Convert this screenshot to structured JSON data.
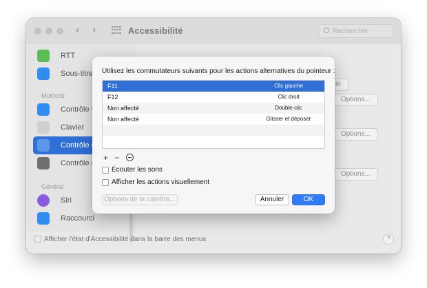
{
  "window": {
    "title": "Accessibilité",
    "search_placeholder": "Rechercher"
  },
  "sidebar": {
    "items": [
      {
        "label": "RTT",
        "icon": "rtt-icon",
        "color": "#5bbd58"
      },
      {
        "label": "Sous-titres",
        "icon": "subtitles-icon",
        "color": "#2f8cf0"
      },
      {
        "label": "Contrôle vo",
        "icon": "voice-control-icon",
        "color": "#2f8cf0"
      },
      {
        "label": "Clavier",
        "icon": "keyboard-icon",
        "color": "#bdbdbd"
      },
      {
        "label": "Contrôle du",
        "icon": "pointer-control-icon",
        "color": "#2f6fd6"
      },
      {
        "label": "Contrôle de",
        "icon": "switch-control-icon",
        "color": "#6e6e6e"
      },
      {
        "label": "Siri",
        "icon": "siri-icon",
        "color": "#8a5be0"
      },
      {
        "label": "Raccourci",
        "icon": "shortcut-icon",
        "color": "#2f8cf0"
      }
    ],
    "sections": [
      "Motricité",
      "Général"
    ]
  },
  "content": {
    "buttons": [
      "le",
      "Options...",
      "Options...",
      "Options..."
    ]
  },
  "footer": {
    "menu_bar_label": "Afficher l'état d'Accessibilité dans la barre des menus",
    "help": "?"
  },
  "sheet": {
    "prompt": "Utilisez les commutateurs suivants pour les actions alternatives du pointeur :",
    "rows": [
      {
        "key": "F11",
        "action": "Clic gauche",
        "selected": true
      },
      {
        "key": "F12",
        "action": "Clic droit",
        "selected": false
      },
      {
        "key": "Non affecté",
        "action": "Double-clic",
        "selected": false
      },
      {
        "key": "Non affecté",
        "action": "Glisser et déposer",
        "selected": false
      }
    ],
    "tools": {
      "add": "+",
      "remove": "−"
    },
    "checkboxes": {
      "sounds": "Écouter les sons",
      "visual": "Afficher les actions visuellement"
    },
    "buttons": {
      "camera": "Options de la caméra...",
      "cancel": "Annuler",
      "ok": "OK"
    }
  },
  "colors": {
    "accent": "#2f7cf6",
    "selection": "#2f6fd6"
  }
}
